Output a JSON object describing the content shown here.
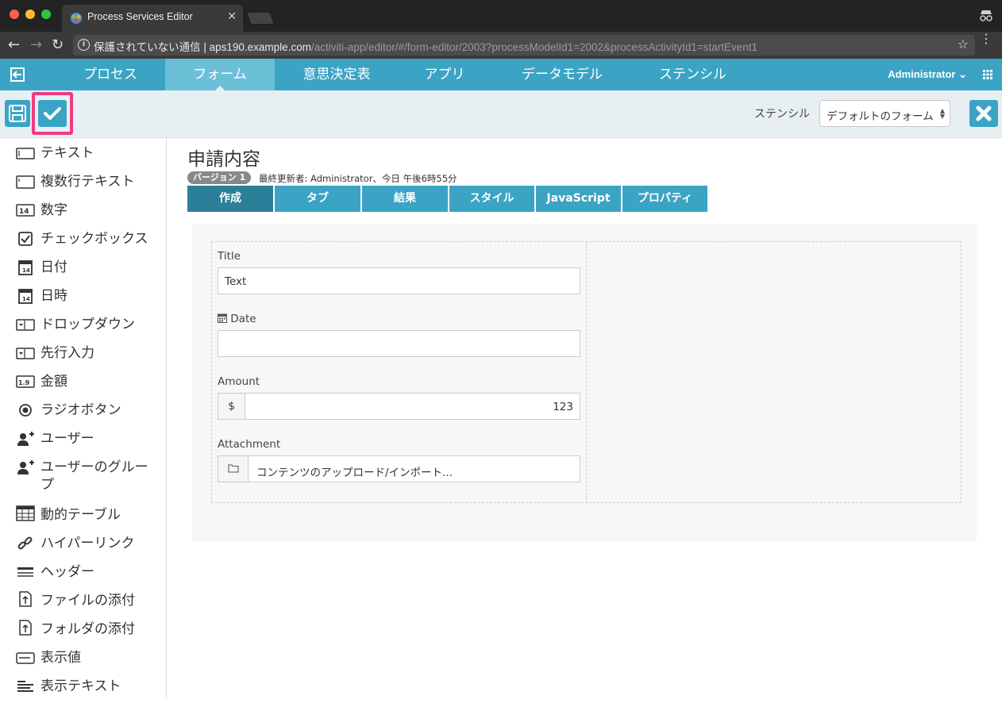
{
  "browser": {
    "tab_title": "Process Services Editor",
    "tab_close": "✕",
    "security_label": "保護されていない通信",
    "url_host": "aps190.example.com",
    "url_path": "/activiti-app/editor/#/form-editor/2003?processModelId1=2002&processActivityId1=startEvent1"
  },
  "nav": {
    "items": [
      {
        "label": "プロセス"
      },
      {
        "label": "フォーム"
      },
      {
        "label": "意思決定表"
      },
      {
        "label": "アプリ"
      },
      {
        "label": "データモデル"
      },
      {
        "label": "ステンシル"
      }
    ],
    "active_index": 1,
    "user": "Administrator"
  },
  "toolbar": {
    "stencil_label": "ステンシル",
    "stencil_value": "デフォルトのフォーム"
  },
  "palette": {
    "items": [
      {
        "label": "テキスト",
        "icon": "text-field-icon"
      },
      {
        "label": "複数行テキスト",
        "icon": "multiline-text-icon"
      },
      {
        "label": "数字",
        "icon": "number-icon"
      },
      {
        "label": "チェックボックス",
        "icon": "checkbox-icon"
      },
      {
        "label": "日付",
        "icon": "calendar-icon"
      },
      {
        "label": "日時",
        "icon": "calendar-icon"
      },
      {
        "label": "ドロップダウン",
        "icon": "dropdown-icon"
      },
      {
        "label": "先行入力",
        "icon": "typeahead-icon"
      },
      {
        "label": "金額",
        "icon": "amount-icon"
      },
      {
        "label": "ラジオボタン",
        "icon": "radio-icon"
      },
      {
        "label": "ユーザー",
        "icon": "user-add-icon"
      },
      {
        "label": "ユーザーのグループ",
        "icon": "group-add-icon"
      },
      {
        "label": "動的テーブル",
        "icon": "table-icon"
      },
      {
        "label": "ハイパーリンク",
        "icon": "link-icon"
      },
      {
        "label": "ヘッダー",
        "icon": "header-icon"
      },
      {
        "label": "ファイルの添付",
        "icon": "file-attach-icon"
      },
      {
        "label": "フォルダの添付",
        "icon": "folder-attach-icon"
      },
      {
        "label": "表示値",
        "icon": "display-value-icon"
      },
      {
        "label": "表示テキスト",
        "icon": "display-text-icon"
      }
    ]
  },
  "form": {
    "title": "申請内容",
    "version": "バージョン 1",
    "last_updated": "最終更新者: Administrator、今日 午後6時55分",
    "tabs": [
      {
        "label": "作成"
      },
      {
        "label": "タブ"
      },
      {
        "label": "結果"
      },
      {
        "label": "スタイル"
      },
      {
        "label": "JavaScript"
      },
      {
        "label": "プロパティ"
      }
    ],
    "fields": {
      "title_label": "Title",
      "title_value": "Text",
      "date_label": "Date",
      "amount_label": "Amount",
      "amount_currency": "$",
      "amount_value": "123",
      "attachment_label": "Attachment",
      "attachment_text": "コンテンツのアップロード/インポート..."
    }
  },
  "colors": {
    "primary": "#3ba4c5",
    "active_nav": "#6bc0d8",
    "active_tab": "#2b7f99",
    "highlight": "#ee3c80"
  }
}
